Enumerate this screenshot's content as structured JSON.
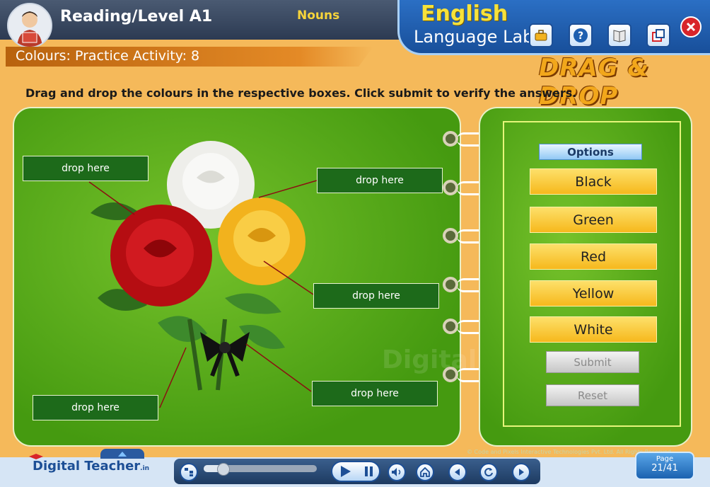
{
  "header": {
    "app_title": "Reading/Level A1",
    "topic": "Nouns",
    "lab_title_line1": "English",
    "lab_title_line2": "Language Lab",
    "tools": [
      "toolbox-icon",
      "help-icon",
      "glossary-icon",
      "window-icon"
    ]
  },
  "activity": {
    "title": "Colours: Practice Activity: 8",
    "banner": "DRAG & DROP",
    "instructions": "Drag and drop the colours in the respective boxes. Click submit to verify the answers."
  },
  "drop_zones": [
    {
      "label": "drop here"
    },
    {
      "label": "drop here"
    },
    {
      "label": "drop here"
    },
    {
      "label": "drop here"
    },
    {
      "label": "drop here"
    }
  ],
  "options": {
    "heading": "Options",
    "items": [
      "Black",
      "Green",
      "Red",
      "Yellow",
      "White"
    ]
  },
  "actions": {
    "submit": "Submit",
    "reset": "Reset"
  },
  "footer": {
    "logo": "Digital Teacher",
    "logo_suffix": ".in",
    "page_label": "Page",
    "page_value": "21/41",
    "progress": 0.17,
    "copyright": "© Code and Pixels Interactive Technologies Pvt. Ltd. All Rights Reserved"
  },
  "watermark": "Digital Teacher",
  "colors": {
    "panel_green": "#5fb11e",
    "option_yellow": "#f6b81c",
    "drop_green": "#1d6a1a",
    "background": "#f5b95a"
  }
}
